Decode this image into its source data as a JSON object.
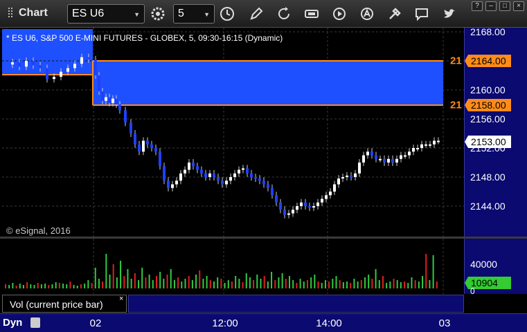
{
  "toolbar": {
    "app_title": "Chart",
    "symbol": "ES U6",
    "interval": "5",
    "icons": [
      "settings-gear-icon",
      "clock-icon",
      "draw-pencil-icon",
      "refresh-icon",
      "get-icon",
      "play-icon",
      "alert-icon",
      "tools-icon",
      "comment-icon",
      "twitter-icon"
    ],
    "window_buttons": [
      "?",
      "–",
      "□",
      "×"
    ]
  },
  "chart": {
    "title": "* ES U6, S&P 500 E-MINI FUTURES - GLOBEX, 5, 09:30-16:15 (Dynamic)",
    "copyright": "© eSignal, 2016",
    "price_labels": [
      "2168.00",
      "2164.00",
      "2160.00",
      "2156.00",
      "2152.00",
      "2148.00",
      "2144.00"
    ],
    "upper_level_tag": "2164.00",
    "lower_level_tag": "2158.00",
    "current_price_tag": "2153.00",
    "upper_level_trunc": "21",
    "lower_level_trunc": "21",
    "colors": {
      "background": "#000000",
      "axis_bg": "#0a0a70",
      "range_fill": "#1e50ff",
      "level_line": "#ff8c1a",
      "up_candle": "#ffffff",
      "down_candle": "#1e40ff",
      "vol_up": "#2ecc40",
      "vol_down": "#e02020",
      "vol_tag": "#33cc33"
    }
  },
  "volume": {
    "axis_label": "40000",
    "zero_label": "0",
    "current_tag": "10904",
    "study_label": "Vol (current price bar)",
    "close_label": "×"
  },
  "time_axis": {
    "labels": [
      "02",
      "12:00",
      "14:00",
      "03"
    ],
    "dyn_label": "Dyn"
  }
}
